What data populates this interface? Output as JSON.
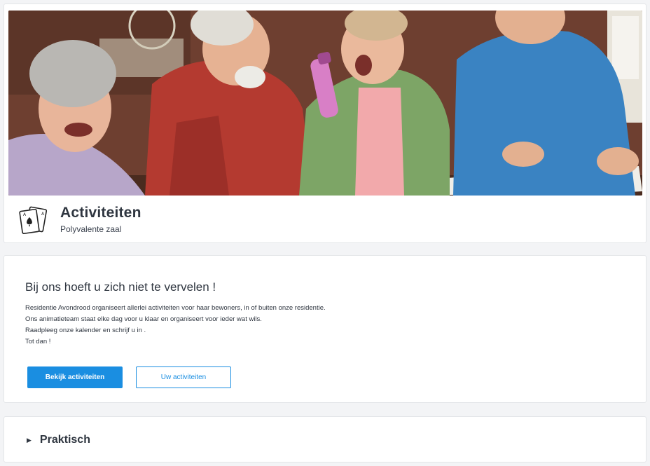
{
  "header": {
    "hero_image": "seniors-playing-bingo-photo",
    "icon": "playing-cards-icon",
    "title": "Activiteiten",
    "subtitle": "Polyvalente zaal"
  },
  "intro": {
    "heading": "Bij ons hoeft u zich niet te vervelen !",
    "lines": [
      "Residentie Avondrood organiseert allerlei activiteiten voor haar bewoners, in of buiten onze residentie.",
      "Ons animatieteam staat elke dag voor u klaar en organiseert voor ieder wat wils.",
      "Raadpleeg onze kalender en schrijf u in .",
      "Tot dan !"
    ],
    "primary_button": "Bekijk activiteiten",
    "secondary_button": "Uw activiteiten"
  },
  "praktisch": {
    "label": "Praktisch",
    "caret_icon": "caret-right-icon"
  },
  "colors": {
    "accent": "#1a8ee1",
    "background": "#f3f4f6",
    "text": "#2f3640"
  }
}
